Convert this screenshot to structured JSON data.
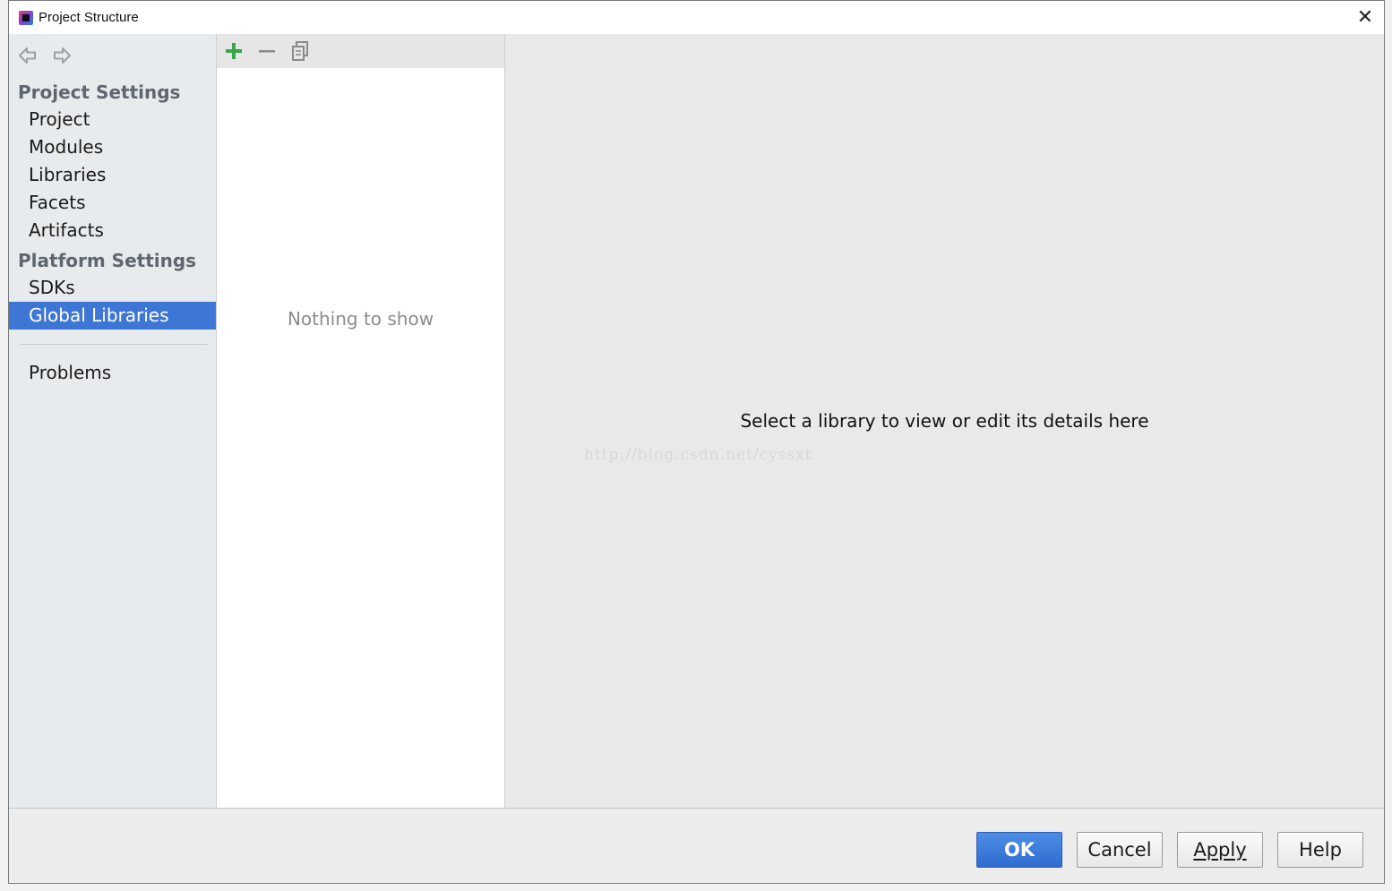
{
  "window": {
    "title": "Project Structure",
    "close_glyph": "✕"
  },
  "sidebar": {
    "project_settings_header": "Project Settings",
    "project_items": [
      {
        "label": "Project"
      },
      {
        "label": "Modules"
      },
      {
        "label": "Libraries"
      },
      {
        "label": "Facets"
      },
      {
        "label": "Artifacts"
      }
    ],
    "platform_settings_header": "Platform Settings",
    "platform_items": [
      {
        "label": "SDKs"
      },
      {
        "label": "Global Libraries",
        "selected": true
      }
    ],
    "problems_label": "Problems"
  },
  "list_panel": {
    "toolbar_icons": [
      "add-icon",
      "remove-icon",
      "copy-icon"
    ],
    "empty_text": "Nothing to show"
  },
  "detail_panel": {
    "hint": "Select a library to view or edit its details here",
    "watermark": "http://blog.csdn.net/cyssxt"
  },
  "footer": {
    "ok": "OK",
    "cancel": "Cancel",
    "apply": "Apply",
    "help": "Help"
  },
  "colors": {
    "selection": "#3d76d4",
    "primary_button": "#3a7bdb",
    "add_green": "#3aa64a"
  }
}
